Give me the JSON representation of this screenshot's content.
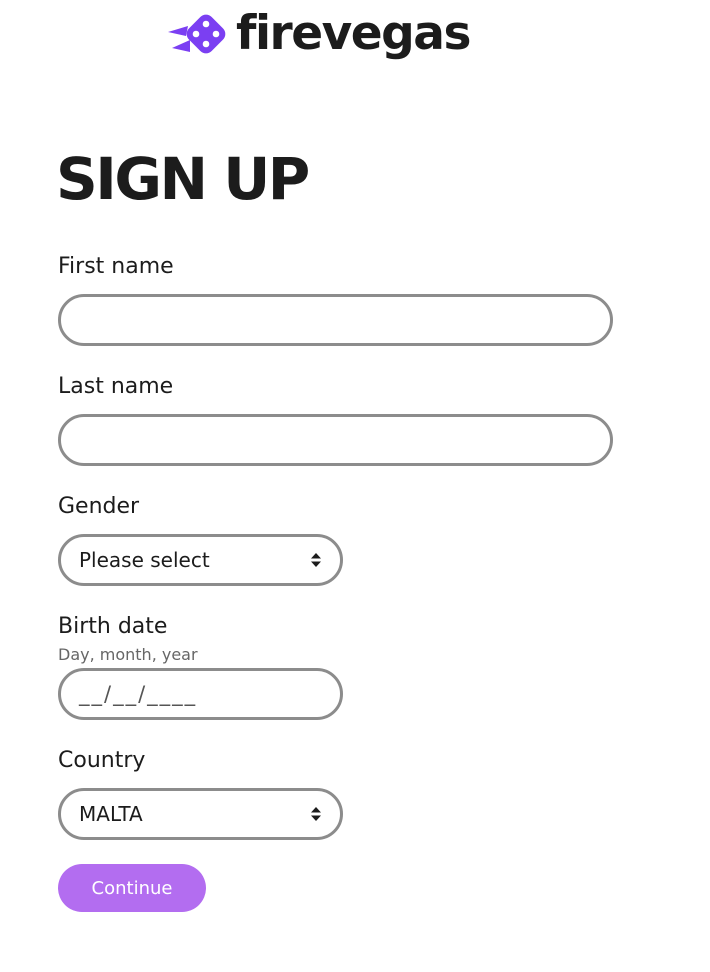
{
  "brand": {
    "name": "firevegas",
    "accent": "#7b3ff2"
  },
  "page": {
    "title": "SIGN UP"
  },
  "form": {
    "first_name": {
      "label": "First name",
      "value": ""
    },
    "last_name": {
      "label": "Last name",
      "value": ""
    },
    "gender": {
      "label": "Gender",
      "selected": "Please select",
      "icon": "select-arrows-icon"
    },
    "birth_date": {
      "label": "Birth date",
      "hint": "Day, month, year",
      "mask": "__/__/____"
    },
    "country": {
      "label": "Country",
      "selected": "MALTA",
      "icon": "select-arrows-icon"
    },
    "submit": {
      "label": "Continue",
      "color": "#b36df0"
    }
  }
}
